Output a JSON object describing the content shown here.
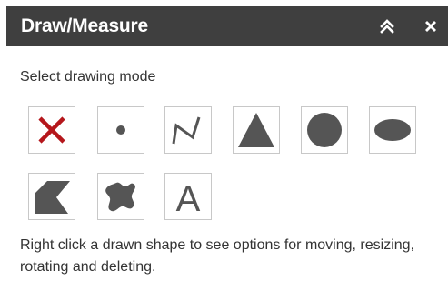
{
  "panel": {
    "title": "Draw/Measure",
    "collapse_icon": "double-chevron-up-icon",
    "close_icon": "close-icon"
  },
  "instruction": "Select drawing mode",
  "tools": [
    {
      "id": "clear",
      "icon": "red-x-icon"
    },
    {
      "id": "point",
      "icon": "dot-icon"
    },
    {
      "id": "polyline",
      "icon": "polyline-icon"
    },
    {
      "id": "triangle",
      "icon": "triangle-icon"
    },
    {
      "id": "circle",
      "icon": "circle-icon"
    },
    {
      "id": "ellipse",
      "icon": "ellipse-icon"
    },
    {
      "id": "polygon",
      "icon": "polygon-icon"
    },
    {
      "id": "freehand",
      "icon": "freehand-shape-icon"
    },
    {
      "id": "text",
      "icon": "text-icon",
      "glyph": "A"
    }
  ],
  "help_text": "Right click a drawn shape to see options for moving, resizing, rotating and deleting.",
  "colors": {
    "titlebar": "#3f3f3f",
    "title_text": "#ffffff",
    "tool_fill": "#555555",
    "clear_x": "#b5171c",
    "tool_border": "#c8c8c8",
    "body_text": "#333333"
  }
}
